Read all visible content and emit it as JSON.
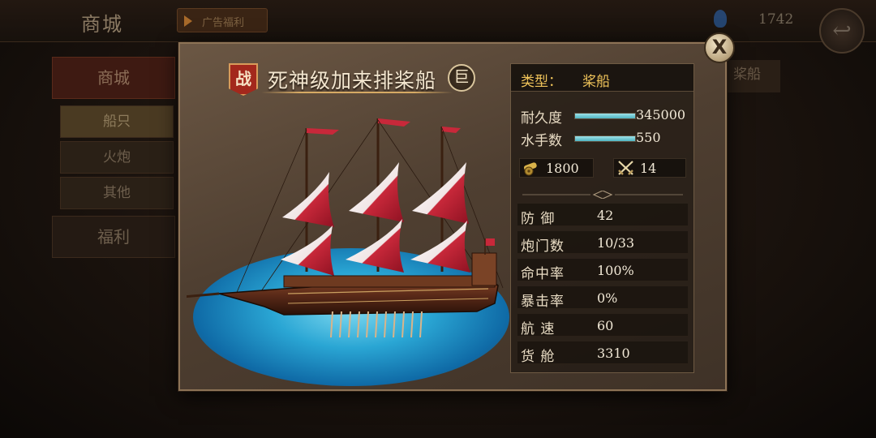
{
  "background": {
    "title": "商城",
    "ad_label": "广告福利",
    "currency_count": "1742",
    "back_icon": "back-arrow-icon",
    "side_menu": [
      "商城",
      "船只",
      "火炮",
      "其他",
      "福利"
    ],
    "right_tab": "桨船"
  },
  "popup": {
    "badge": "战",
    "ship_name": "死神级加来排桨船",
    "size_badge": "巨",
    "close_label": "X",
    "type_label": "类型：",
    "type_value": "桨船",
    "durability": {
      "label": "耐久度",
      "value": "345000",
      "fill": 1.0
    },
    "sailors": {
      "label": "水手数",
      "value": "550",
      "fill": 1.0
    },
    "cargo_icon_value": "1800",
    "cargo_icon": "cannon-icon",
    "crew_icon_value": "14",
    "crew_icon": "crossed-swords-icon",
    "attributes": [
      {
        "label": "防  御",
        "value": "42"
      },
      {
        "label": "炮门数",
        "value": "10/33"
      },
      {
        "label": "命中率",
        "value": "100%"
      },
      {
        "label": "暴击率",
        "value": "0%"
      },
      {
        "label": "航  速",
        "value": "60"
      },
      {
        "label": "货  舱",
        "value": "3310"
      }
    ]
  },
  "colors": {
    "accent_gold": "#f0c45a",
    "bar_fill": "#6cc6d2",
    "water": "#2aa6d4",
    "sail_red": "#c8283a"
  }
}
